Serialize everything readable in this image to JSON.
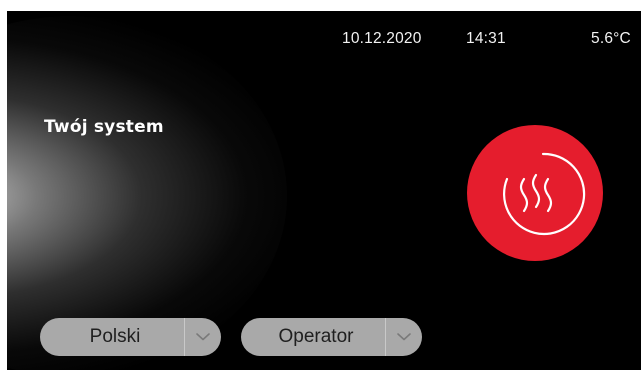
{
  "status_bar": {
    "date": "10.12.2020",
    "time": "14:31",
    "outdoor_temperature": "5.6°C"
  },
  "main": {
    "title": "Twój system",
    "heating_button": {
      "icon": "heating-icon",
      "color": "#e51d2d"
    }
  },
  "footer": {
    "language_select": {
      "selected": "Polski",
      "icon": "chevron-down-icon"
    },
    "role_select": {
      "selected": "Operator",
      "icon": "chevron-down-icon"
    }
  }
}
